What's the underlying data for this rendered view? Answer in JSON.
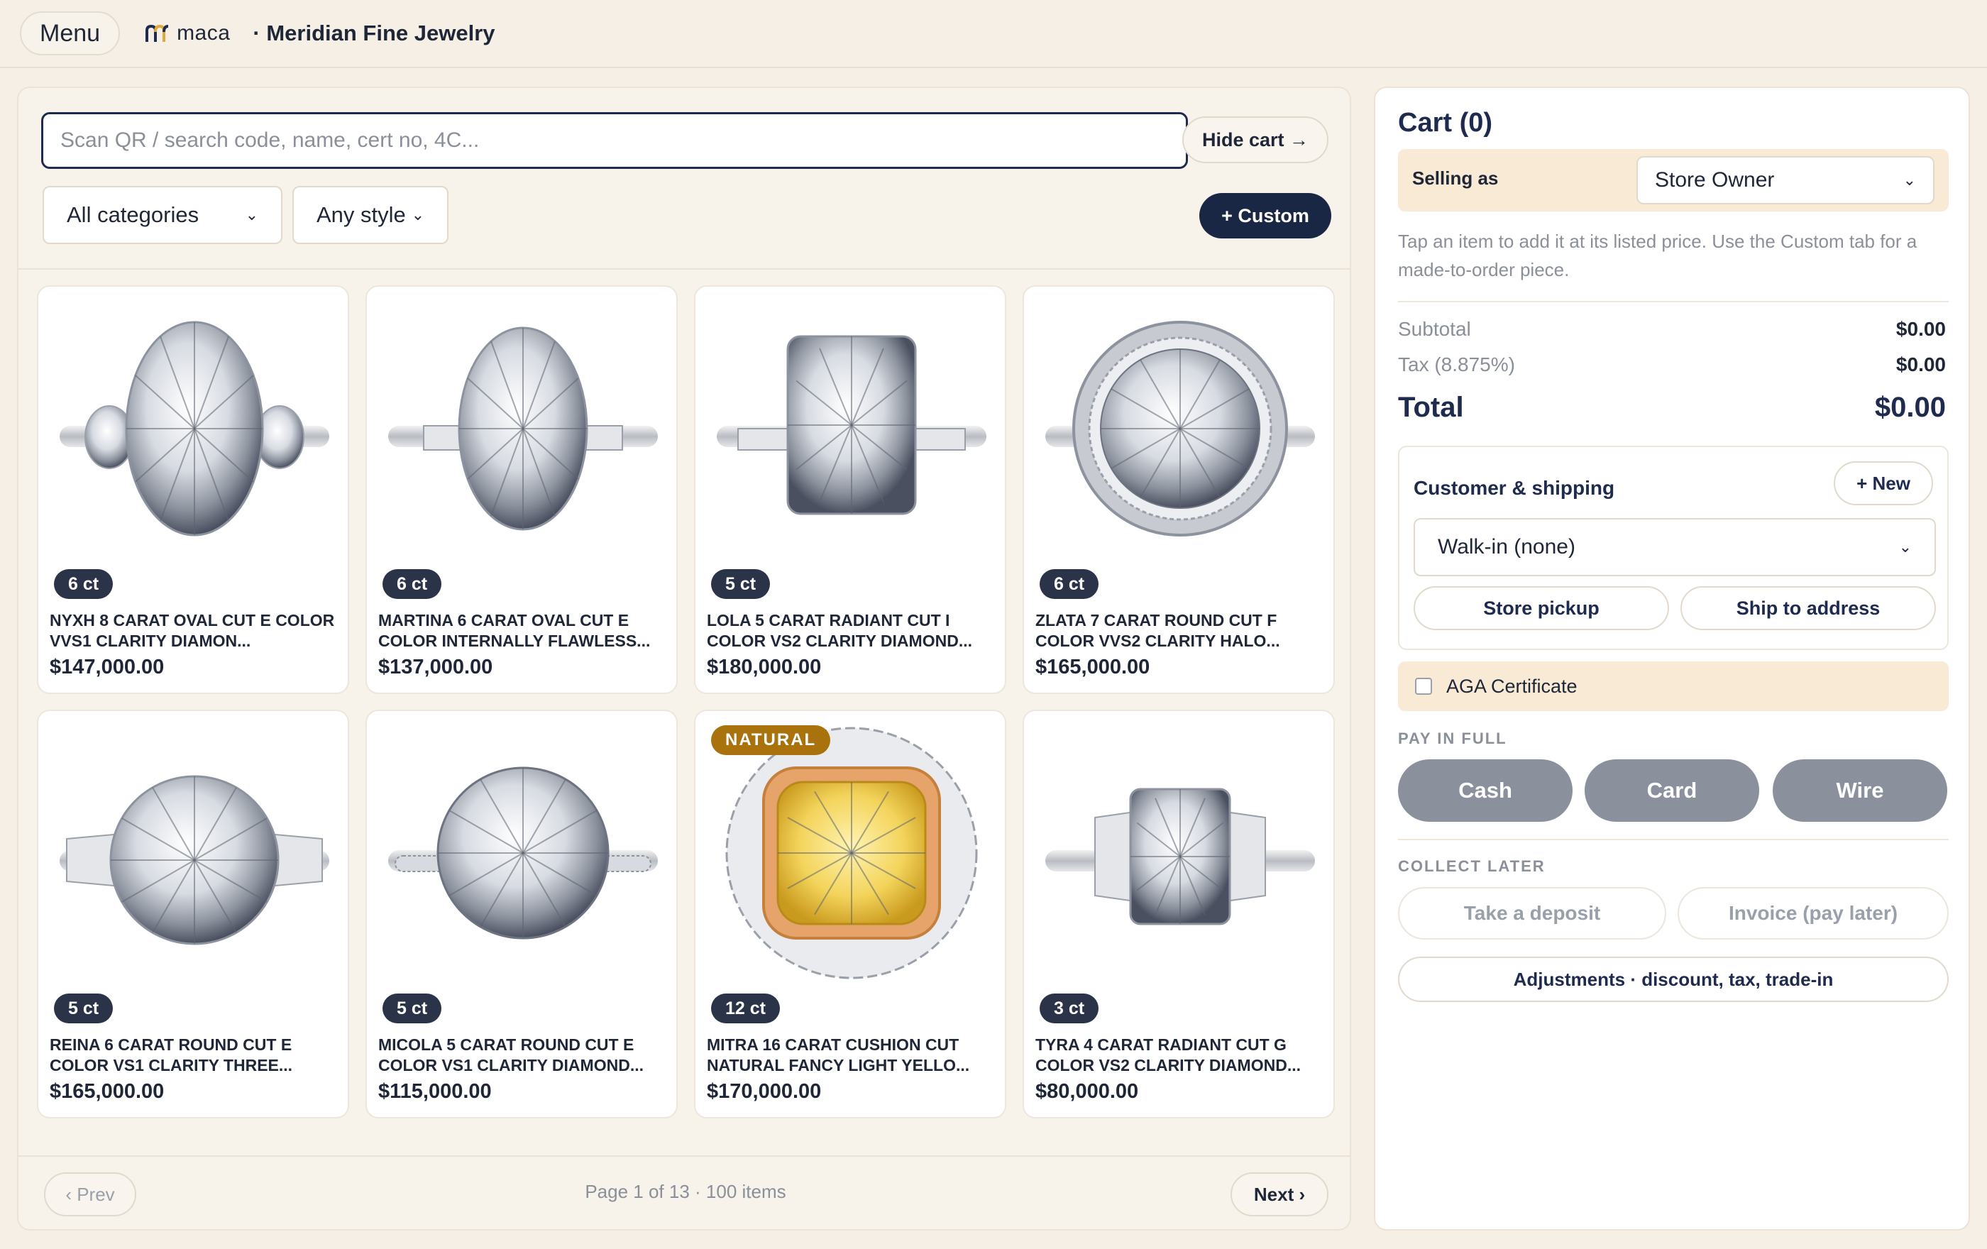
{
  "header": {
    "menu_label": "Menu",
    "brand_name": "maca",
    "store_name": "· Meridian Fine Jewelry"
  },
  "catalog": {
    "search_placeholder": "Scan QR / search code, name, cert no, 4C...",
    "search_value": "",
    "hide_cart_label": "Hide cart →",
    "category_select": "All categories",
    "style_select": "Any style",
    "custom_label": "+ Custom",
    "products": [
      {
        "carat_badge": "6 ct",
        "title": "NYXH 8 CARAT OVAL CUT E COLOR VVS1 CLARITY DIAMON...",
        "price": "$147,000.00",
        "shape": "oval",
        "natural_badge": ""
      },
      {
        "carat_badge": "6 ct",
        "title": "MARTINA 6 CARAT OVAL CUT E COLOR INTERNALLY FLAWLESS...",
        "price": "$137,000.00",
        "shape": "oval-baguette",
        "natural_badge": ""
      },
      {
        "carat_badge": "5 ct",
        "title": "LOLA 5 CARAT RADIANT CUT I COLOR VS2 CLARITY DIAMOND...",
        "price": "$180,000.00",
        "shape": "radiant",
        "natural_badge": ""
      },
      {
        "carat_badge": "6 ct",
        "title": "ZLATA 7 CARAT ROUND CUT F COLOR VVS2 CLARITY HALO...",
        "price": "$165,000.00",
        "shape": "round-halo",
        "natural_badge": ""
      },
      {
        "carat_badge": "5 ct",
        "title": "REINA 6 CARAT ROUND CUT E COLOR VS1 CLARITY THREE...",
        "price": "$165,000.00",
        "shape": "round-three",
        "natural_badge": ""
      },
      {
        "carat_badge": "5 ct",
        "title": "MICOLA 5 CARAT ROUND CUT E COLOR VS1 CLARITY DIAMOND...",
        "price": "$115,000.00",
        "shape": "round-pave",
        "natural_badge": ""
      },
      {
        "carat_badge": "12 ct",
        "title": "MITRA 16 CARAT CUSHION CUT NATURAL FANCY LIGHT YELLO...",
        "price": "$170,000.00",
        "shape": "cushion-yellow",
        "natural_badge": "NATURAL"
      },
      {
        "carat_badge": "3 ct",
        "title": "TYRA 4 CARAT RADIANT CUT G COLOR VS2 CLARITY DIAMOND...",
        "price": "$80,000.00",
        "shape": "radiant-trap",
        "natural_badge": ""
      }
    ],
    "pager": {
      "prev_label": "‹ Prev",
      "info": "Page 1 of 13 · 100 items",
      "next_label": "Next ›"
    }
  },
  "cart": {
    "title": "Cart (0)",
    "selling_as_label": "Selling as",
    "selling_as_value": "Store Owner",
    "hint": "Tap an item to add it at its listed price. Use the Custom tab for a made-to-order piece.",
    "subtotal_label": "Subtotal",
    "subtotal_value": "$0.00",
    "tax_label": "Tax (8.875%)",
    "tax_value": "$0.00",
    "total_label": "Total",
    "total_value": "$0.00",
    "customer_label": "Customer & shipping",
    "new_label": "+ New",
    "customer_select": "Walk-in (none)",
    "store_pickup_label": "Store pickup",
    "ship_label": "Ship to address",
    "aga_label": "AGA Certificate",
    "aga_checked": false,
    "pay_in_full_label": "PAY IN FULL",
    "pay_buttons": [
      "Cash",
      "Card",
      "Wire"
    ],
    "collect_later_label": "COLLECT LATER",
    "deposit_label": "Take a deposit",
    "invoice_label": "Invoice (pay later)",
    "adjustments_label": "Adjustments · discount, tax, trade-in"
  },
  "colors": {
    "page_bg": "#f5efe6",
    "navy": "#1a2744",
    "badge_dark": "#2b3349",
    "natural_gold": "#a9720c",
    "highlight_row": "#f8ead5",
    "pay_gray": "#8a919c"
  }
}
